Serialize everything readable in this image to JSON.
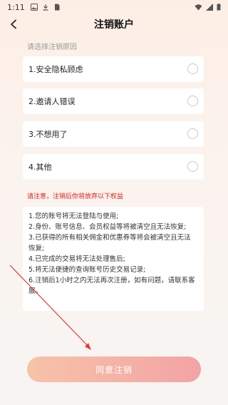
{
  "status_bar": {
    "time": "1:11"
  },
  "header": {
    "title": "注销账户"
  },
  "reasons_section": {
    "label": "请选择注销原因",
    "items": [
      {
        "label": "1.安全隐私顾虑"
      },
      {
        "label": "2.邀请人错误"
      },
      {
        "label": "3.不想用了"
      },
      {
        "label": "4.其他"
      }
    ]
  },
  "warning": "请注意，注销后你将放弃以下权益",
  "terms": [
    "1.您的账号将无法登陆与使用;",
    "2.身份、账号信息、会员权益等将被清空且无法恢复;",
    "3.已获得的所有相关佣金和优惠券等将会被清空且无法",
    "恢复;",
    "4.已完成的交易将无法处理售后;",
    "5.将无法便捷的查询账号历史交易记录;",
    "6.注销后1小时之内无法再次注册，如有问题，请联系客",
    "服。"
  ],
  "agree_button": {
    "label": "同意注销"
  },
  "colors": {
    "accent_gradient_start": "#f6c3a8",
    "accent_gradient_end": "#f3a3a6",
    "warning": "#e0201a"
  }
}
